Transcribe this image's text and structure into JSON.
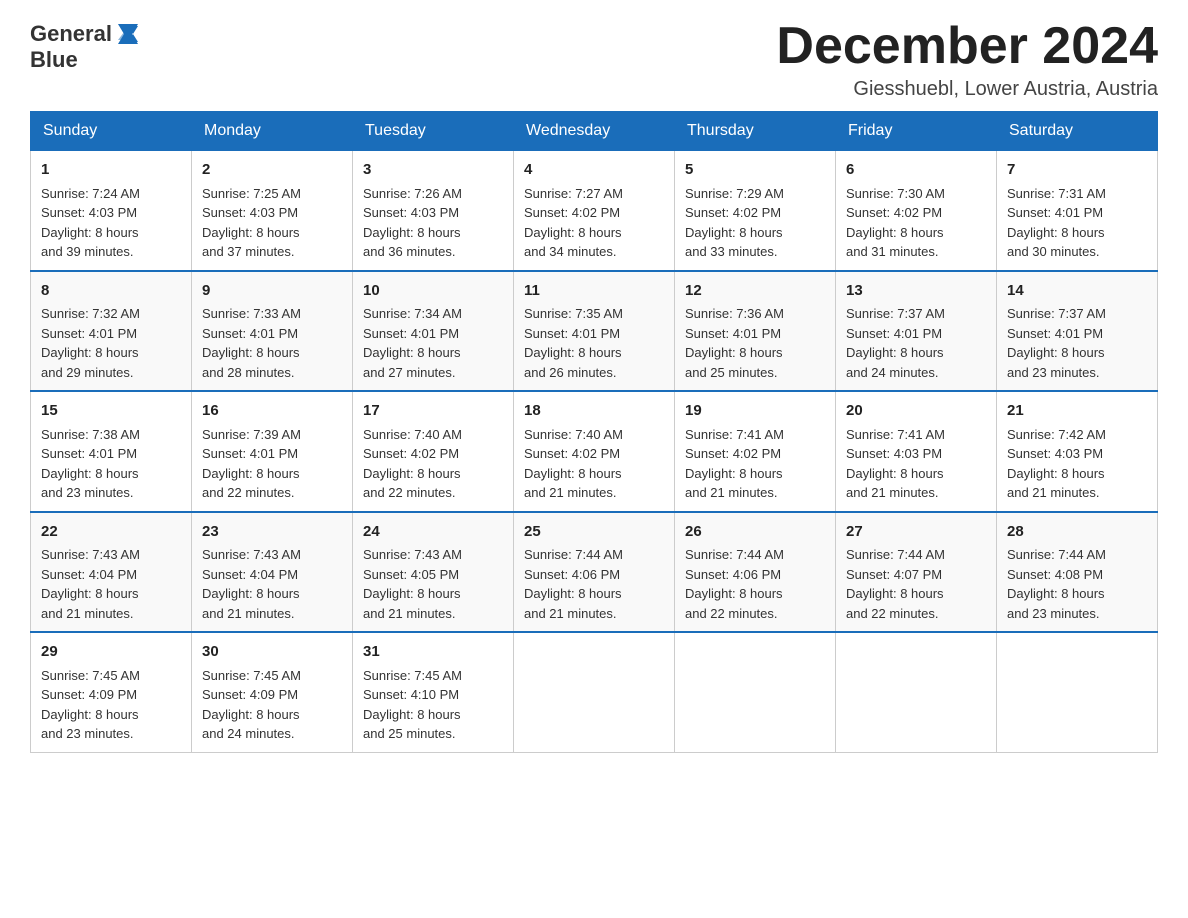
{
  "logo": {
    "text_general": "General",
    "text_blue": "Blue",
    "aria": "GeneralBlue logo"
  },
  "title": "December 2024",
  "location": "Giesshuebl, Lower Austria, Austria",
  "days_of_week": [
    "Sunday",
    "Monday",
    "Tuesday",
    "Wednesday",
    "Thursday",
    "Friday",
    "Saturday"
  ],
  "weeks": [
    [
      {
        "day": "1",
        "sunrise": "7:24 AM",
        "sunset": "4:03 PM",
        "daylight": "8 hours and 39 minutes."
      },
      {
        "day": "2",
        "sunrise": "7:25 AM",
        "sunset": "4:03 PM",
        "daylight": "8 hours and 37 minutes."
      },
      {
        "day": "3",
        "sunrise": "7:26 AM",
        "sunset": "4:03 PM",
        "daylight": "8 hours and 36 minutes."
      },
      {
        "day": "4",
        "sunrise": "7:27 AM",
        "sunset": "4:02 PM",
        "daylight": "8 hours and 34 minutes."
      },
      {
        "day": "5",
        "sunrise": "7:29 AM",
        "sunset": "4:02 PM",
        "daylight": "8 hours and 33 minutes."
      },
      {
        "day": "6",
        "sunrise": "7:30 AM",
        "sunset": "4:02 PM",
        "daylight": "8 hours and 31 minutes."
      },
      {
        "day": "7",
        "sunrise": "7:31 AM",
        "sunset": "4:01 PM",
        "daylight": "8 hours and 30 minutes."
      }
    ],
    [
      {
        "day": "8",
        "sunrise": "7:32 AM",
        "sunset": "4:01 PM",
        "daylight": "8 hours and 29 minutes."
      },
      {
        "day": "9",
        "sunrise": "7:33 AM",
        "sunset": "4:01 PM",
        "daylight": "8 hours and 28 minutes."
      },
      {
        "day": "10",
        "sunrise": "7:34 AM",
        "sunset": "4:01 PM",
        "daylight": "8 hours and 27 minutes."
      },
      {
        "day": "11",
        "sunrise": "7:35 AM",
        "sunset": "4:01 PM",
        "daylight": "8 hours and 26 minutes."
      },
      {
        "day": "12",
        "sunrise": "7:36 AM",
        "sunset": "4:01 PM",
        "daylight": "8 hours and 25 minutes."
      },
      {
        "day": "13",
        "sunrise": "7:37 AM",
        "sunset": "4:01 PM",
        "daylight": "8 hours and 24 minutes."
      },
      {
        "day": "14",
        "sunrise": "7:37 AM",
        "sunset": "4:01 PM",
        "daylight": "8 hours and 23 minutes."
      }
    ],
    [
      {
        "day": "15",
        "sunrise": "7:38 AM",
        "sunset": "4:01 PM",
        "daylight": "8 hours and 23 minutes."
      },
      {
        "day": "16",
        "sunrise": "7:39 AM",
        "sunset": "4:01 PM",
        "daylight": "8 hours and 22 minutes."
      },
      {
        "day": "17",
        "sunrise": "7:40 AM",
        "sunset": "4:02 PM",
        "daylight": "8 hours and 22 minutes."
      },
      {
        "day": "18",
        "sunrise": "7:40 AM",
        "sunset": "4:02 PM",
        "daylight": "8 hours and 21 minutes."
      },
      {
        "day": "19",
        "sunrise": "7:41 AM",
        "sunset": "4:02 PM",
        "daylight": "8 hours and 21 minutes."
      },
      {
        "day": "20",
        "sunrise": "7:41 AM",
        "sunset": "4:03 PM",
        "daylight": "8 hours and 21 minutes."
      },
      {
        "day": "21",
        "sunrise": "7:42 AM",
        "sunset": "4:03 PM",
        "daylight": "8 hours and 21 minutes."
      }
    ],
    [
      {
        "day": "22",
        "sunrise": "7:43 AM",
        "sunset": "4:04 PM",
        "daylight": "8 hours and 21 minutes."
      },
      {
        "day": "23",
        "sunrise": "7:43 AM",
        "sunset": "4:04 PM",
        "daylight": "8 hours and 21 minutes."
      },
      {
        "day": "24",
        "sunrise": "7:43 AM",
        "sunset": "4:05 PM",
        "daylight": "8 hours and 21 minutes."
      },
      {
        "day": "25",
        "sunrise": "7:44 AM",
        "sunset": "4:06 PM",
        "daylight": "8 hours and 21 minutes."
      },
      {
        "day": "26",
        "sunrise": "7:44 AM",
        "sunset": "4:06 PM",
        "daylight": "8 hours and 22 minutes."
      },
      {
        "day": "27",
        "sunrise": "7:44 AM",
        "sunset": "4:07 PM",
        "daylight": "8 hours and 22 minutes."
      },
      {
        "day": "28",
        "sunrise": "7:44 AM",
        "sunset": "4:08 PM",
        "daylight": "8 hours and 23 minutes."
      }
    ],
    [
      {
        "day": "29",
        "sunrise": "7:45 AM",
        "sunset": "4:09 PM",
        "daylight": "8 hours and 23 minutes."
      },
      {
        "day": "30",
        "sunrise": "7:45 AM",
        "sunset": "4:09 PM",
        "daylight": "8 hours and 24 minutes."
      },
      {
        "day": "31",
        "sunrise": "7:45 AM",
        "sunset": "4:10 PM",
        "daylight": "8 hours and 25 minutes."
      },
      null,
      null,
      null,
      null
    ]
  ],
  "labels": {
    "sunrise": "Sunrise:",
    "sunset": "Sunset:",
    "daylight": "Daylight:"
  }
}
